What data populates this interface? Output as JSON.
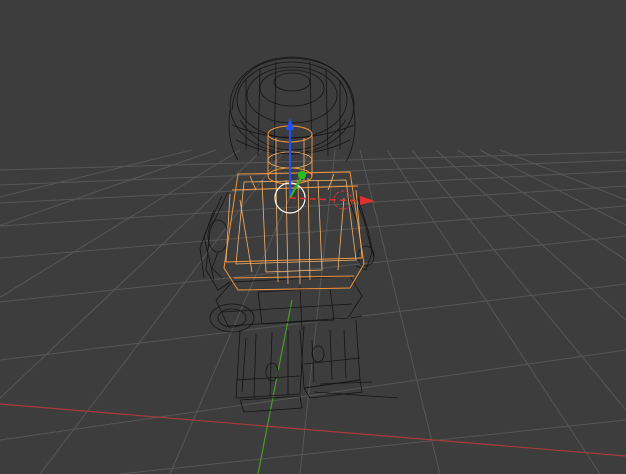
{
  "viewport": {
    "background_color": "#3d3d3d",
    "grid_color": "#575757",
    "x_axis_color": "#a83a3a",
    "y_axis_color": "#4a9a2a",
    "wireframe_color": "#141414",
    "selection_color": "#f0943a",
    "view_mode": "wireframe"
  },
  "scene_objects": [
    {
      "name": "minifig-head",
      "selected": false
    },
    {
      "name": "minifig-hair",
      "selected": false
    },
    {
      "name": "minifig-torso",
      "selected": true
    },
    {
      "name": "minifig-neck",
      "selected": true
    },
    {
      "name": "minifig-left-arm",
      "selected": false
    },
    {
      "name": "minifig-right-arm",
      "selected": false
    },
    {
      "name": "minifig-hips",
      "selected": false
    },
    {
      "name": "minifig-legs",
      "selected": false
    }
  ],
  "manipulator": {
    "x_handle_color": "#e23030",
    "y_handle_color": "#20c020",
    "z_handle_color": "#2050ff",
    "view_circle_color": "#ffffff"
  }
}
